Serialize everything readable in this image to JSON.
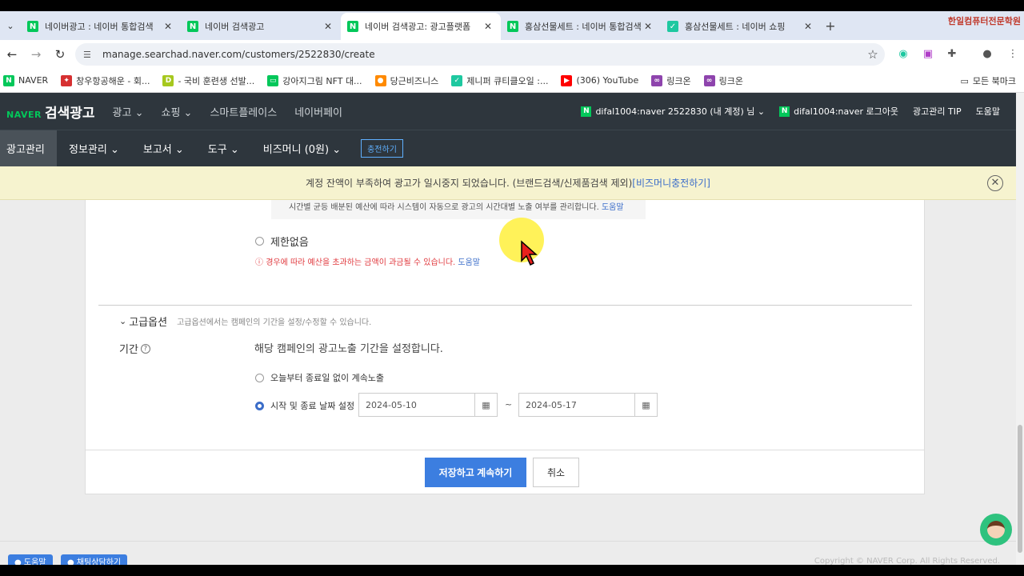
{
  "browser": {
    "tabs": [
      {
        "title": "네이버광고 : 네이버 통합검색",
        "icon": "N",
        "active": false
      },
      {
        "title": "네이버 검색광고",
        "icon": "N",
        "active": false
      },
      {
        "title": "네이버 검색광고: 광고플랫폼",
        "icon": "N",
        "active": true
      },
      {
        "title": "홍삼선물세트 : 네이버 통합검색",
        "icon": "N",
        "active": false
      },
      {
        "title": "홍삼선물세트 : 네이버 쇼핑",
        "icon": "shop",
        "active": false
      }
    ],
    "brand_badge": "한일컴퓨터전문학원",
    "url": "manage.searchad.naver.com/customers/2522830/create",
    "bookmarks": [
      {
        "label": "NAVER",
        "color": "#03c75a",
        "glyph": "N"
      },
      {
        "label": "창우항공해운 - 회...",
        "color": "#d63031",
        "glyph": "✦"
      },
      {
        "label": "- 국비 훈련생 선발...",
        "color": "#a6c81e",
        "glyph": "D"
      },
      {
        "label": "강아지그림 NFT 대...",
        "color": "#03c75a",
        "glyph": "▭"
      },
      {
        "label": "당근비즈니스",
        "color": "#ff8a00",
        "glyph": "●"
      },
      {
        "label": "제니퍼 큐티클오일 :...",
        "color": "#1ec8a0",
        "glyph": "✓"
      },
      {
        "label": "(306) YouTube",
        "color": "#ff0000",
        "glyph": "▶"
      },
      {
        "label": "링크온",
        "color": "#8e44ad",
        "glyph": "∞"
      },
      {
        "label": "링크온",
        "color": "#8e44ad",
        "glyph": "∞"
      }
    ],
    "bookmarks_folder": "모든 북마크"
  },
  "header": {
    "logo_naver": "NAVER",
    "logo_title": "검색광고",
    "gnb": [
      "광고 ⌄",
      "쇼핑 ⌄",
      "스마트플레이스",
      "네이버페이"
    ],
    "account": "difal1004:naver  2522830 (내 계정) 님 ⌄",
    "logout": "difal1004:naver 로그아웃",
    "tip": "광고관리 TIP",
    "help": "도움말"
  },
  "lnb": {
    "items": [
      "광고관리",
      "정보관리 ⌄",
      "보고서 ⌄",
      "도구 ⌄",
      "비즈머니 (0원) ⌄"
    ],
    "charge": "충전하기"
  },
  "notice": {
    "text": "계정 잔액이 부족하여 광고가 일시중지 되었습니다. (브랜드검색/신제품검색 제외)",
    "link": "[비즈머니충전하기]"
  },
  "budget": {
    "prev_desc": "시간별 균등 배분된 예산에 따라 시스템이 자동으로 광고의 시간대별 노출 여부를 관리합니다.",
    "prev_help": "도움말",
    "unlimited_label": "제한없음",
    "warning": "경우에 따라 예산을 초과하는 금액이 과금될 수 있습니다.",
    "warning_help": "도움말"
  },
  "advanced": {
    "title": "고급옵션",
    "desc": "고급옵션에서는 캠페인의 기간을 설정/수정할 수 있습니다.",
    "period_label": "기간",
    "period_desc": "해당 캠페인의 광고노출 기간을 설정합니다.",
    "option_continuous": "오늘부터 종료일 없이 계속노출",
    "option_range": "시작 및 종료 날짜 설정",
    "start_date": "2024-05-10",
    "end_date": "2024-05-17",
    "tilde": "~"
  },
  "actions": {
    "save": "저장하고 계속하기",
    "cancel": "취소"
  },
  "footer": {
    "help": "도움말",
    "chat": "채팅상담하기",
    "copyright": "Copyright © NAVER Corp. All Rights Reserved."
  }
}
